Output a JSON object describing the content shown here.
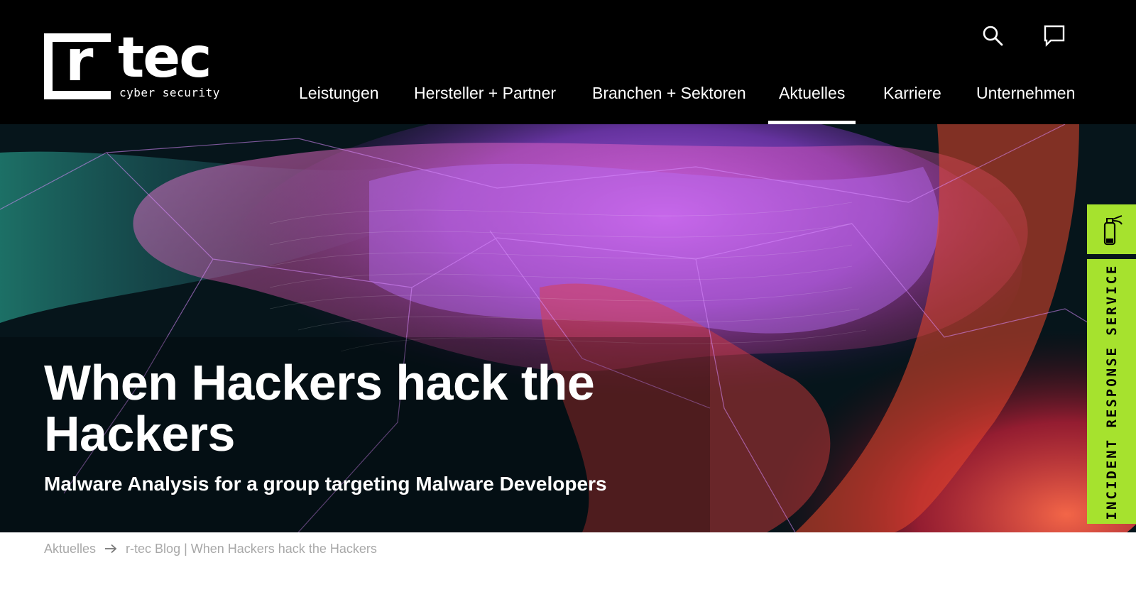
{
  "brand": {
    "logo_letter": "r",
    "logo_word": "tec",
    "logo_tagline": "cyber security"
  },
  "header": {
    "icons": [
      "search-icon",
      "chat-icon"
    ],
    "nav": [
      {
        "label": "Leistungen",
        "active": false
      },
      {
        "label": "Hersteller + Partner",
        "active": false
      },
      {
        "label": "Branchen + Sektoren",
        "active": false
      },
      {
        "label": "Aktuelles",
        "active": true
      },
      {
        "label": "Karriere",
        "active": false
      },
      {
        "label": "Unternehmen",
        "active": false
      }
    ]
  },
  "hero": {
    "title": "When Hackers hack the Hackers",
    "subtitle": "Malware Analysis for a group targeting Malware Developers"
  },
  "incident_tab": {
    "icon": "fire-extinguisher-icon",
    "label": "INCIDENT RESPONSE SERVICE",
    "color": "#a6e22e"
  },
  "breadcrumb": {
    "parent": "Aktuelles",
    "separator_icon": "arrow-right-icon",
    "current": "r-tec Blog | When Hackers hack the Hackers"
  }
}
